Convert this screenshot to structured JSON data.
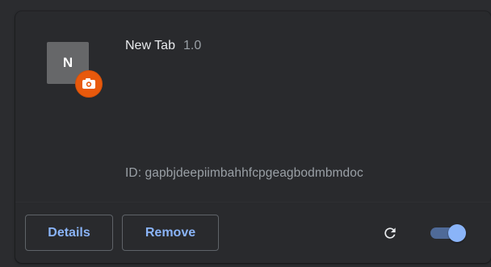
{
  "extension": {
    "icon_letter": "N",
    "name": "New Tab",
    "version": "1.0",
    "id_text": "ID: gapbjdeepiimbahhfcpgeagbodmbmdoc",
    "badge_icon": "camera-badge-icon"
  },
  "actions": {
    "details_label": "Details",
    "remove_label": "Remove",
    "reload_icon": "reload-icon",
    "toggle_state": "on"
  },
  "colors": {
    "accent": "#8ab4f8",
    "badge": "#e8590c",
    "card_bg": "#292a2d"
  }
}
